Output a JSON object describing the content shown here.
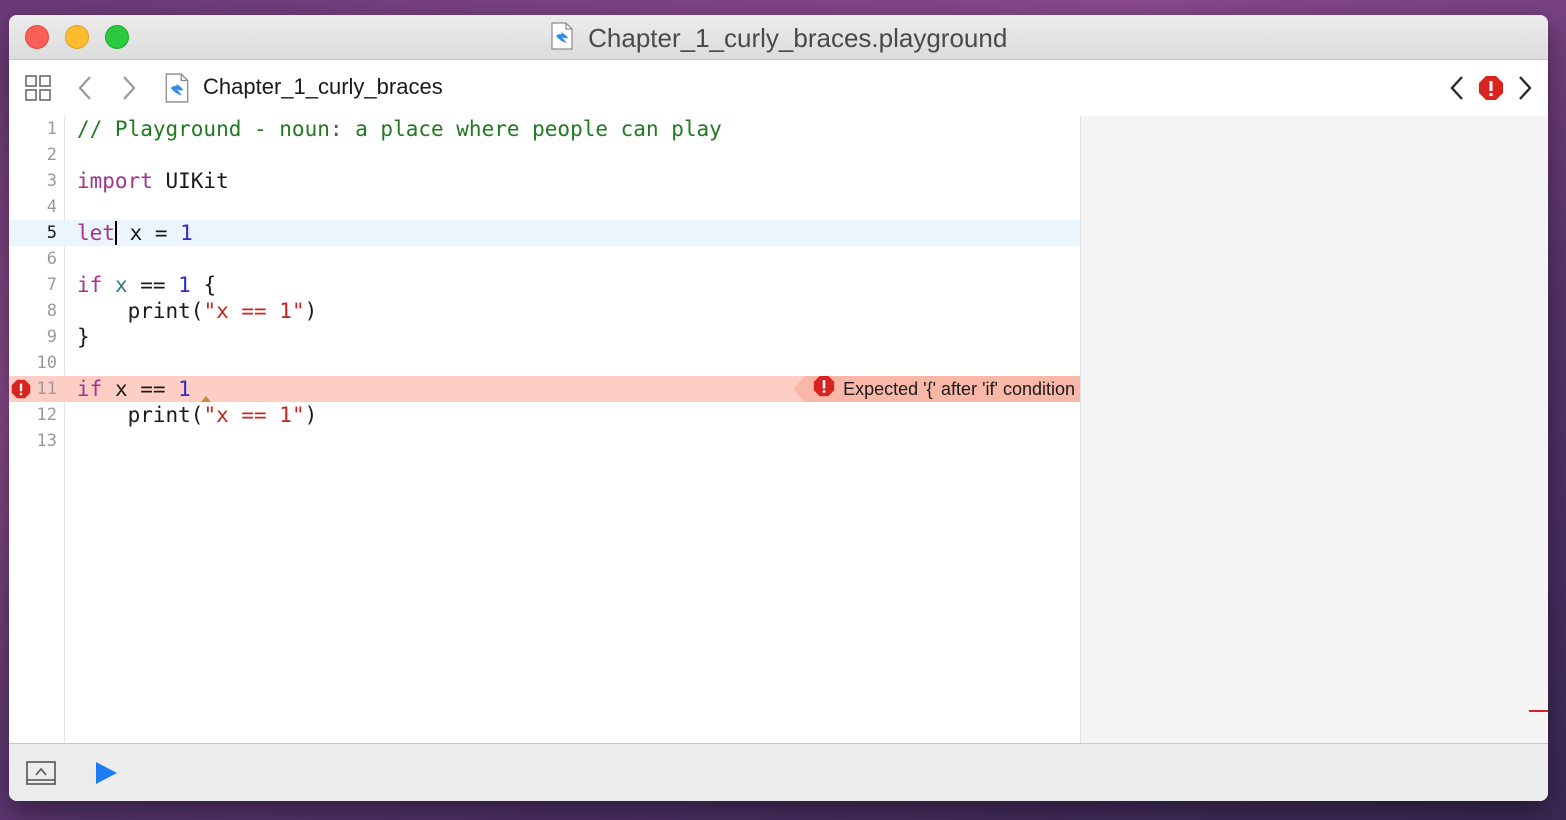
{
  "window": {
    "title": "Chapter_1_curly_braces.playground"
  },
  "toolbar": {
    "breadcrumb": "Chapter_1_curly_braces",
    "icons": {
      "grid": "grid-icon",
      "back": "chevron-left-icon",
      "forward": "chevron-right-icon",
      "prev_issue": "chevron-left-icon",
      "issue": "error-icon",
      "next_issue": "chevron-right-icon"
    }
  },
  "editor": {
    "current_line": 5,
    "error_line": 11,
    "lines": [
      {
        "n": "1"
      },
      {
        "n": "2"
      },
      {
        "n": "3"
      },
      {
        "n": "4"
      },
      {
        "n": "5"
      },
      {
        "n": "6"
      },
      {
        "n": "7"
      },
      {
        "n": "8"
      },
      {
        "n": "9"
      },
      {
        "n": "10"
      },
      {
        "n": "11"
      },
      {
        "n": "12"
      },
      {
        "n": "13"
      }
    ],
    "code": {
      "l1": "// Playground - noun: a place where people can play",
      "l3_kw": "import",
      "l3_rest": " UIKit",
      "l5_kw": "let",
      "l5_rest": " x = ",
      "l5_num": "1",
      "l7_kw": "if",
      "l7_var": " x",
      "l7_op": " == ",
      "l7_num": "1",
      "l7_brace": " {",
      "l8_indent": "    ",
      "l8_fn": "print(",
      "l8_str": "\"x == 1\"",
      "l8_close": ")",
      "l9": "}",
      "l11_kw": "if",
      "l11_rest": " x == ",
      "l11_num": "1",
      "l12_indent": "    ",
      "l12_fn": "print(",
      "l12_str": "\"x == 1\"",
      "l12_close": ")"
    },
    "error_message": "Expected '{' after 'if' condition"
  },
  "colors": {
    "comment": "#1f7a1f",
    "keyword": "#a4328f",
    "number": "#2d2bd0",
    "string": "#c4261f",
    "error_bg": "#fdcfc4",
    "current_line_bg": "#ecf5fd",
    "run_button": "#1e7cf2"
  },
  "bottombar": {
    "icons": {
      "toggle": "show-debug-area-icon",
      "run": "play-icon"
    }
  }
}
